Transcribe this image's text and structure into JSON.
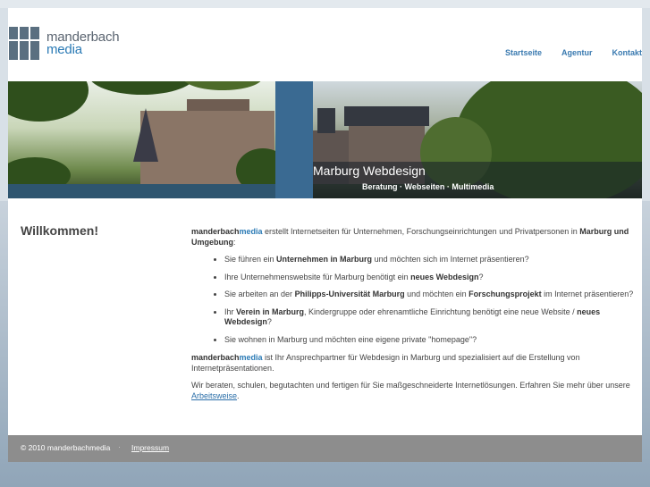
{
  "logo": {
    "line1": "manderbach",
    "line2": "media"
  },
  "nav": {
    "items": [
      "Startseite",
      "Agentur",
      "Kontakt"
    ]
  },
  "banner": {
    "title": "Marburg Webdesign",
    "subtitle": "Beratung · Webseiten · Multimedia"
  },
  "welcome": "Willkommen!",
  "intro": {
    "brand_a": "manderbach",
    "brand_b": "media",
    "text1": " erstellt Internetseiten für Unternehmen, Forschungseinrichtungen und Privatpersonen in ",
    "bold1": "Marburg und Umgebung",
    "text2": ":"
  },
  "list": [
    {
      "t1": "Sie führen ein ",
      "b1": "Unternehmen in Marburg",
      "t2": " und möchten sich im Internet präsentieren?",
      "b2": "",
      "t3": ""
    },
    {
      "t1": "Ihre Unternehmenswebsite für Marburg benötigt ein ",
      "b1": "neues Webdesign",
      "t2": "?",
      "b2": "",
      "t3": ""
    },
    {
      "t1": "Sie arbeiten an der ",
      "b1": "Philipps-Universität Marburg",
      "t2": " und möchten ein ",
      "b2": "Forschungsprojekt",
      "t3": " im Internet präsentieren?"
    },
    {
      "t1": "Ihr ",
      "b1": "Verein in Marburg",
      "t2": ", Kindergruppe oder ehrenamtliche Einrichtung benötigt eine neue Website / ",
      "b2": "neues Webdesign",
      "t3": "?"
    },
    {
      "t1": "Sie wohnen in Marburg und möchten eine eigene private \"homepage\"?",
      "b1": "",
      "t2": "",
      "b2": "",
      "t3": ""
    }
  ],
  "outro1": {
    "brand_a": "manderbach",
    "brand_b": "media",
    "text": " ist Ihr Ansprechpartner für Webdesign in Marburg und spezialisiert auf die Erstellung von Internetpräsentationen."
  },
  "outro2": {
    "text": "Wir beraten, schulen, begutachten und fertigen für Sie maßgeschneiderte Internetlösungen. Erfahren Sie mehr über unsere ",
    "link": "Arbeitsweise",
    "end": "."
  },
  "footer": {
    "copyright": "© 2010 manderbachmedia",
    "separator": "·",
    "impressum": "Impressum"
  },
  "colors": {
    "accent": "#2a7ab5",
    "banner_blue": "#3a6a92",
    "footer": "#8d8d8d"
  }
}
